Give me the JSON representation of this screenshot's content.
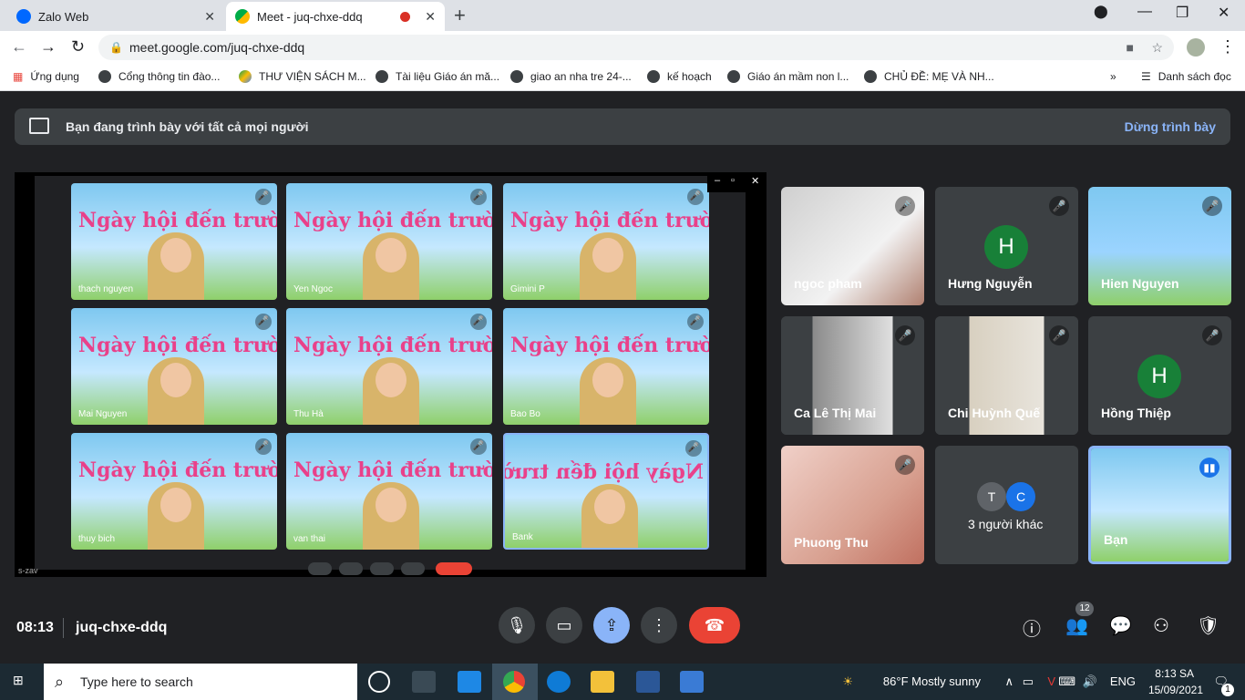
{
  "browser": {
    "tabs": [
      {
        "title": "Zalo Web",
        "active": false,
        "icon": "zalo-icon"
      },
      {
        "title": "Meet - juq-chxe-ddq",
        "active": true,
        "icon": "meet-icon"
      }
    ],
    "url": "meet.google.com/juq-chxe-ddq",
    "bookmarks": [
      "Ứng dụng",
      "Cổng thông tin đào...",
      "THƯ VIỆN SÁCH M...",
      "Tài liệu Giáo án mă...",
      "giao an nha tre 24-...",
      "kế hoạch",
      "Giáo án mầm non l...",
      "CHỦ ĐỀ: MẸ VÀ NH..."
    ],
    "reading_list": "Danh sách đọc"
  },
  "meet": {
    "banner_text": "Bạn đang trình bày với tất cả mọi người",
    "stop_presenting": "Dừng trình bày",
    "shared_screen": {
      "slide_title": "Ngày hội đến trường của bé",
      "participants": [
        "thach nguyen",
        "Yen Ngoc",
        "Gimini P",
        "Mai Nguyen",
        "Thu Hà",
        "Bao Bo",
        "thuy bich",
        "van thai",
        "Bank"
      ],
      "bottom_label": "s-zav"
    },
    "tiles": [
      {
        "name": "ngoc pham",
        "avatar": "",
        "muted": true
      },
      {
        "name": "Hưng Nguyễn",
        "avatar": "H",
        "muted": true
      },
      {
        "name": "Hien Nguyen",
        "avatar": "",
        "muted": true
      },
      {
        "name": "Ca Lê Thị Mai",
        "avatar": "",
        "muted": true
      },
      {
        "name": "Chi Huỳnh Quế",
        "avatar": "",
        "muted": true
      },
      {
        "name": "Hồng Thiệp",
        "avatar": "H",
        "muted": true
      },
      {
        "name": "Phuong Thu",
        "avatar": "",
        "muted": true
      },
      {
        "name": "3 người khác",
        "avatar": "",
        "mini_avatars": [
          "T",
          "C"
        ]
      },
      {
        "name": "Bạn",
        "avatar": "",
        "speaking": true
      }
    ],
    "time": "08:13",
    "meeting_code": "juq-chxe-ddq",
    "participant_count": "12"
  },
  "taskbar": {
    "search_placeholder": "Type here to search",
    "weather": "86°F  Mostly sunny",
    "language": "ENG",
    "time": "8:13 SA",
    "date": "15/09/2021",
    "notifications": "1"
  }
}
